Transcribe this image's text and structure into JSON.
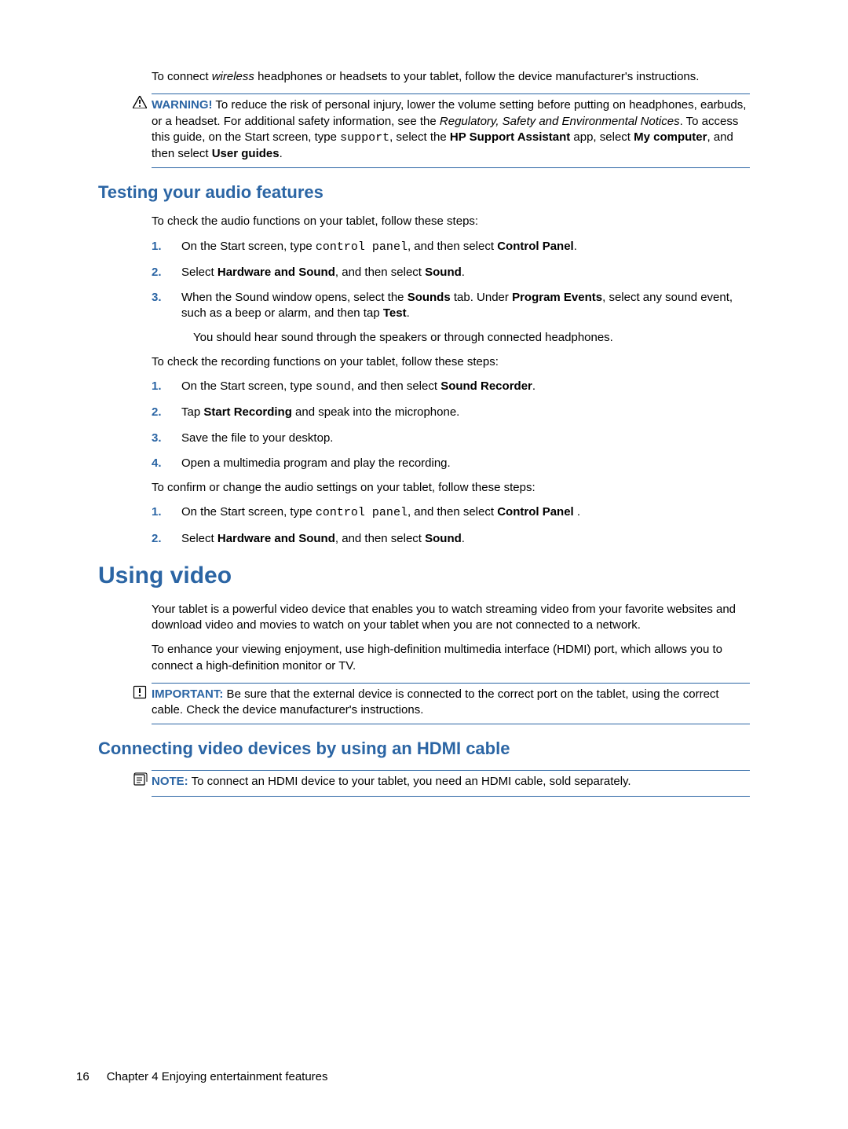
{
  "intro": {
    "p1a": "To connect ",
    "p1_em": "wireless",
    "p1b": " headphones or headsets to your tablet, follow the device manufacturer's instructions."
  },
  "warning": {
    "label": "WARNING!",
    "t1": "   To reduce the risk of personal injury, lower the volume setting before putting on headphones, earbuds, or a headset. For additional safety information, see the ",
    "em": "Regulatory, Safety and Environmental Notices",
    "t2": ". To access this guide, on the Start screen, type ",
    "mono": "support",
    "t3": ", select the ",
    "b1": "HP Support Assistant",
    "t4": " app, select ",
    "b2": "My computer",
    "t5": ", and then select ",
    "b3": "User guides",
    "t6": "."
  },
  "section1": {
    "title": "Testing your audio features",
    "p1": "To check the audio functions on your tablet, follow these steps:",
    "list1": {
      "n1": "1.",
      "i1_a": "On the Start screen, type ",
      "i1_mono": "control panel",
      "i1_b": ", and then select ",
      "i1_bold": "Control Panel",
      "i1_c": ".",
      "n2": "2.",
      "i2_a": "Select ",
      "i2_b1": "Hardware and Sound",
      "i2_b": ", and then select ",
      "i2_b2": "Sound",
      "i2_c": ".",
      "n3": "3.",
      "i3_a": "When the Sound window opens, select the ",
      "i3_b1": "Sounds",
      "i3_b": " tab. Under ",
      "i3_b2": "Program Events",
      "i3_c": ", select any sound event, such as a beep or alarm, and then tap ",
      "i3_b3": "Test",
      "i3_d": ".",
      "i3_sub": "You should hear sound through the speakers or through connected headphones."
    },
    "p2": "To check the recording functions on your tablet, follow these steps:",
    "list2": {
      "n1": "1.",
      "i1_a": "On the Start screen, type ",
      "i1_mono": "sound",
      "i1_b": ", and then select ",
      "i1_bold": "Sound Recorder",
      "i1_c": ".",
      "n2": "2.",
      "i2_a": "Tap ",
      "i2_b1": "Start Recording",
      "i2_b": " and speak into the microphone.",
      "n3": "3.",
      "i3": "Save the file to your desktop.",
      "n4": "4.",
      "i4": "Open a multimedia program and play the recording."
    },
    "p3": "To confirm or change the audio settings on your tablet, follow these steps:",
    "list3": {
      "n1": "1.",
      "i1_a": "On the Start screen, type ",
      "i1_mono": "control panel",
      "i1_b": ", and then select ",
      "i1_bold": "Control Panel",
      "i1_c": " .",
      "n2": "2.",
      "i2_a": "Select ",
      "i2_b1": "Hardware and Sound",
      "i2_b": ", and then select ",
      "i2_b2": "Sound",
      "i2_c": "."
    }
  },
  "section2": {
    "title": "Using video",
    "p1": "Your tablet is a powerful video device that enables you to watch streaming video from your favorite websites and download video and movies to watch on your tablet when you are not connected to a network.",
    "p2": "To enhance your viewing enjoyment, use high-definition multimedia interface (HDMI) port, which allows you to connect a high-definition monitor or TV."
  },
  "important": {
    "label": "IMPORTANT:",
    "text": "   Be sure that the external device is connected to the correct port on the tablet, using the correct cable. Check the device manufacturer's instructions."
  },
  "section3": {
    "title": "Connecting video devices by using an HDMI cable"
  },
  "note": {
    "label": "NOTE:",
    "text": "   To connect an HDMI device to your tablet, you need an HDMI cable, sold separately."
  },
  "footer": {
    "pagenum": "16",
    "chapter": "Chapter 4   Enjoying entertainment features"
  }
}
